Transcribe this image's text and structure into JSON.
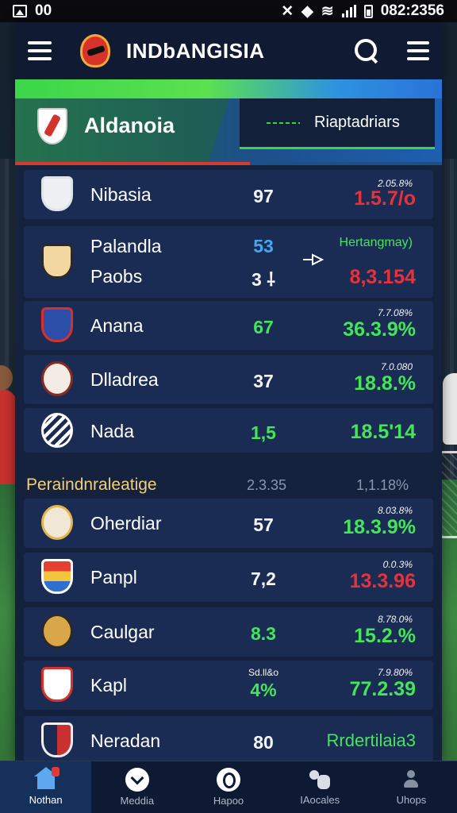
{
  "status_bar": {
    "left_text": "00",
    "time": "082:2356"
  },
  "header": {
    "title": "INDbANGISIA"
  },
  "banner": {
    "team_name": "Aldanoia",
    "tab_label": "Riaptadriars"
  },
  "rows": [
    {
      "name": "Nibasia",
      "score": "97",
      "meta": "2.05.8%",
      "pct": "1.5.7/o",
      "pct_color": "red",
      "score_color": "white"
    },
    {
      "name": "Palandla",
      "name2": "Paobs",
      "score": "53",
      "score2": "3 ⸸",
      "meta": "Hertangmay)",
      "pct": "8,3.154",
      "pct_color": "red",
      "score_color": "blue"
    },
    {
      "name": "Anana",
      "score": "67",
      "meta": "7.7.08%",
      "pct": "36.3.9%",
      "pct_color": "green",
      "score_color": "green"
    },
    {
      "name": "Dlladrea",
      "score": "37",
      "meta": "7.0.080",
      "pct": "18.8.%",
      "pct_color": "green",
      "score_color": "white"
    },
    {
      "name": "Nada",
      "score": "1,5",
      "meta": "",
      "pct": "18.5'14",
      "pct_color": "green",
      "score_color": "green"
    },
    {
      "name": "Oherdiar",
      "score": "57",
      "meta": "8.03.8%",
      "pct": "18.3.9%",
      "pct_color": "green",
      "score_color": "white"
    },
    {
      "name": "Panpl",
      "score": "7,2",
      "meta": "0.0.3%",
      "pct": "13.3.96",
      "pct_color": "red",
      "score_color": "white"
    },
    {
      "name": "Caulgar",
      "score": "8.3",
      "meta": "8.78.0%",
      "pct": "15.2.%",
      "pct_color": "green",
      "score_color": "green"
    },
    {
      "name": "Kapl",
      "score": "4%",
      "score_top": "Sd.ll&o",
      "meta": "7.9.80%",
      "pct": "77.2.39",
      "pct_color": "green",
      "score_color": "green"
    },
    {
      "name": "Neradan",
      "score": "80",
      "meta": "",
      "pct": "Rrdertilaia3",
      "pct_color": "green",
      "score_color": "white"
    }
  ],
  "section": {
    "label": "Peraindnraleatige",
    "val1": "2.3.35",
    "val2": "1,1.18%"
  },
  "nav": [
    {
      "label": "Nothan",
      "icon": "home-icon"
    },
    {
      "label": "Meddia",
      "icon": "chevron-circle-icon"
    },
    {
      "label": "Hapoo",
      "icon": "ring-circle-icon"
    },
    {
      "label": "IAocales",
      "icon": "people-icon"
    },
    {
      "label": "Uhops",
      "icon": "person-icon"
    }
  ],
  "colors": {
    "green": "#44e55a",
    "red": "#e6333a",
    "blue": "#45a7f0",
    "accent_nav": "#16305c"
  }
}
